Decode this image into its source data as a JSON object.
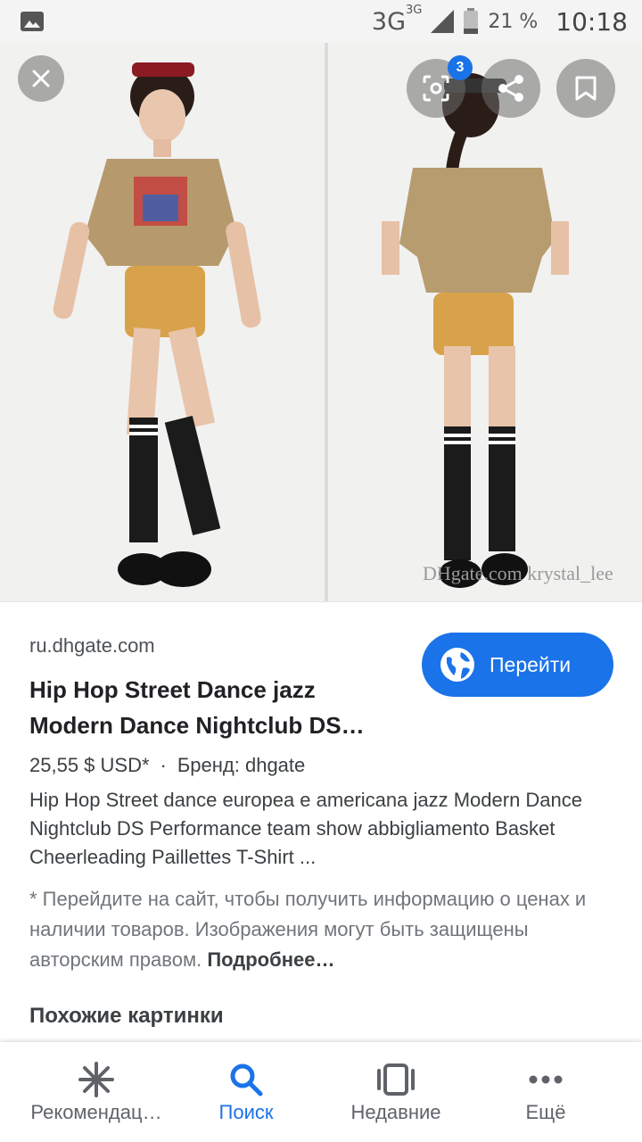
{
  "status_bar": {
    "network": "3G",
    "network_secondary": "3G",
    "battery": "21 %",
    "time": "10:18"
  },
  "image_viewer": {
    "lens_count": "3",
    "watermark": "DHgate.com  krystal_lee",
    "icons": [
      "close-icon",
      "lens-icon",
      "share-icon",
      "bookmark-icon"
    ]
  },
  "result": {
    "domain": "ru.dhgate.com",
    "title": "Hip Hop Street Dance jazz Modern Dance Nightclub DS…",
    "go_button": "Перейти",
    "price": "25,55 $ USD*",
    "separator": "·",
    "brand": "Бренд: dhgate",
    "description": "Hip Hop Street dance europea e americana jazz Modern Dance Nightclub DS Performance team show abbigliamento Basket Cheerleading Paillettes T-Shirt ...",
    "note": "* Перейдите на сайт, чтобы получить информацию о ценах и наличии товаров. Изображения могут быть защищены авторским правом.",
    "note_more": "Подробнее…",
    "similar_heading": "Похожие картинки"
  },
  "bottom_nav": {
    "items": [
      {
        "label": "Рекомендац…",
        "icon": "asterisk-icon",
        "active": false
      },
      {
        "label": "Поиск",
        "icon": "search-icon",
        "active": true
      },
      {
        "label": "Недавние",
        "icon": "recent-icon",
        "active": false
      },
      {
        "label": "Ещё",
        "icon": "more-icon",
        "active": false
      }
    ]
  },
  "colors": {
    "accent": "#1a73e8",
    "text_primary": "#202124",
    "text_secondary": "#70757a"
  }
}
